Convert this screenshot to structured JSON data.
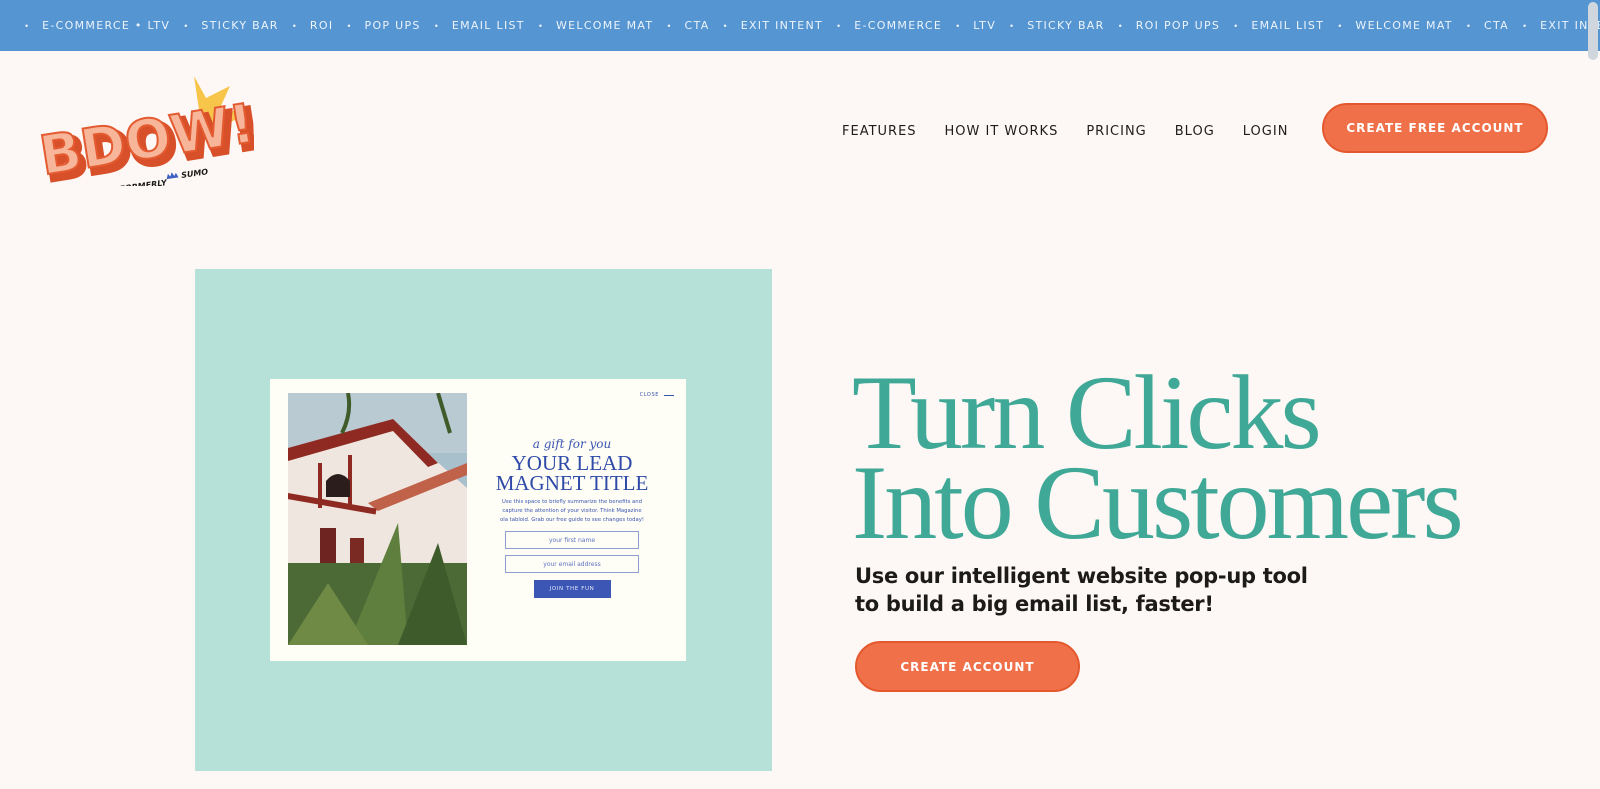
{
  "marquee": {
    "items": [
      "E-COMMERCE • LTV",
      "STICKY BAR",
      "ROI",
      "POP UPS",
      "EMAIL LIST",
      "WELCOME MAT",
      "CTA",
      "EXIT INTENT",
      "E-COMMERCE",
      "LTV",
      "STICKY BAR",
      "ROI POP UPS",
      "EMAIL LIST",
      "WELCOME MAT",
      "CTA",
      "EXIT INTENT",
      "E"
    ],
    "bg_color": "#5495d2"
  },
  "header": {
    "logo_text": "BDOW!",
    "logo_subtext_prefix": "FORMERLY",
    "logo_subtext_brand": "SUMO",
    "nav": [
      "FEATURES",
      "HOW IT WORKS",
      "PRICING",
      "BLOG",
      "LOGIN"
    ],
    "cta_label": "CREATE FREE ACCOUNT"
  },
  "hero": {
    "popup": {
      "close_label": "CLOSE",
      "eyebrow": "a gift for you",
      "title_line1": "YOUR LEAD",
      "title_line2": "MAGNET TITLE",
      "blurb": "Use this space to briefly summarize the benefits and capture the attention of your visitor. Think Magazine ola tabloid. Grab our free guide to see changes today!",
      "first_name_placeholder": "your first name",
      "email_placeholder": "your email address",
      "submit_label": "JOIN THE FUN"
    },
    "headline_line1": "Turn Clicks",
    "headline_line2": "Into Customers",
    "subhead_line1": "Use our intelligent website pop-up tool",
    "subhead_line2": "to build a big email list, faster!",
    "cta_label": "CREATE ACCOUNT"
  },
  "colors": {
    "accent": "#f0704a",
    "teal": "#3fa896",
    "mint": "#b6e1d9",
    "popup_blue": "#3c56b6",
    "background": "#fdf8f5"
  }
}
